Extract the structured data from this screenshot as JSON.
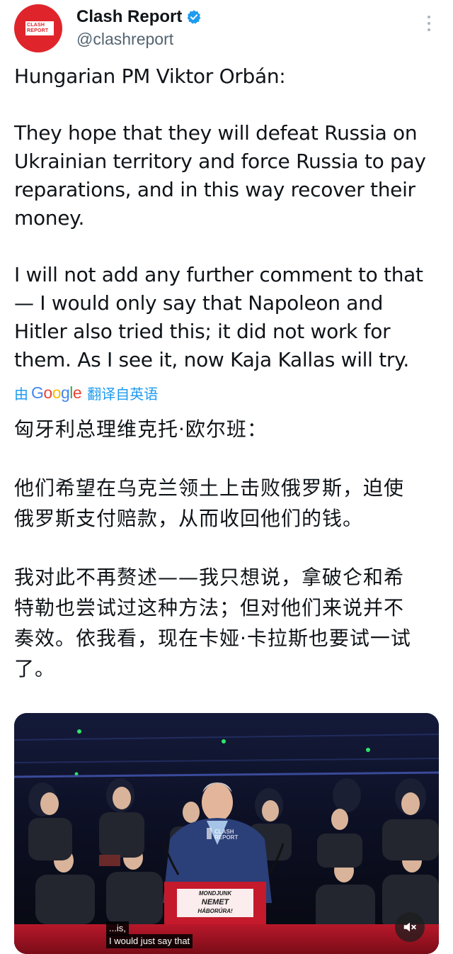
{
  "account": {
    "display_name": "Clash Report",
    "handle": "@clashreport",
    "avatar_text_line1": "CLASH",
    "avatar_text_line2": "REPORT",
    "verified": true,
    "brand_color": "#e0242b",
    "verified_color": "#1d9bf0"
  },
  "tweet": {
    "paragraphs": [
      [
        "Hungarian PM Viktor Orbán:"
      ],
      [
        "They hope that they will defeat Russia on",
        "Ukrainian territory and force Russia to pay",
        "reparations, and in this way recover their",
        "money."
      ],
      [
        "I will not add any further comment to that",
        "— I would only say that Napoleon and",
        "Hitler also tried this; it did not work for",
        "them. As I see it, now Kaja Kallas will try."
      ]
    ]
  },
  "translation": {
    "by_label": "由",
    "provider": "Google",
    "suffix": "翻译自英语",
    "paragraphs": [
      [
        "匈牙利总理维克托·欧尔班："
      ],
      [
        "他们希望在乌克兰领土上击败俄罗斯，迫使",
        "俄罗斯支付赔款，从而收回他们的钱。"
      ],
      [
        "我对此不再赘述——我只想说，拿破仑和希",
        "特勒也尝试过这种方法；但对他们来说并不",
        "奏效。依我看，现在卡娅·卡拉斯也要试一试",
        "了。"
      ]
    ]
  },
  "video": {
    "watermark_line1": "CLASH",
    "watermark_line2": "REPORT",
    "podium_line1": "MONDJUNK",
    "podium_line2": "NEMET",
    "podium_line3": "HÁBORÚRA!",
    "subtitle_line1": "...is,",
    "subtitle_line2": "I would just say that",
    "mute_icon": "speaker-muted-icon"
  },
  "icons": {
    "more": "more-options-icon",
    "verified": "verified-badge-icon"
  }
}
